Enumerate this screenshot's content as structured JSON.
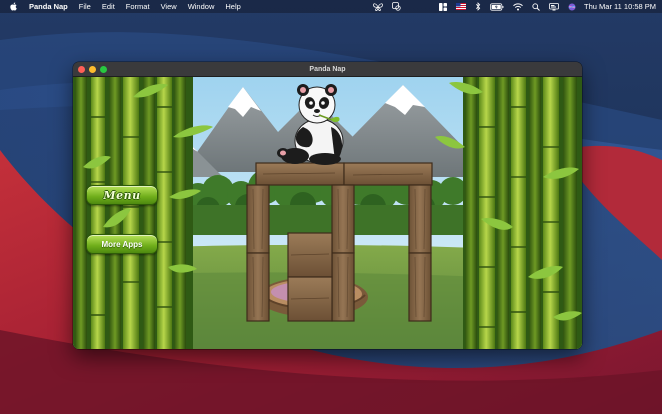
{
  "menubar": {
    "app_name": "Panda Nap",
    "menus": [
      "File",
      "Edit",
      "Format",
      "View",
      "Window",
      "Help"
    ],
    "clock": "Thu Mar 11  10:58 PM",
    "status_icons": [
      "butterfly-icon",
      "screen-share-icon",
      "control-center-grid-icon",
      "us-flag-icon",
      "bluetooth-icon",
      "battery-icon",
      "wifi-icon",
      "spotlight-search-icon",
      "display-icon",
      "siri-icon"
    ]
  },
  "window": {
    "title": "Panda Nap"
  },
  "game": {
    "menu_button": "Menu",
    "more_apps_button": "More Apps"
  },
  "colors": {
    "button_green": "#7bbc22",
    "sky": "#bfe3f6",
    "grass": "#6a9a3a",
    "wood": "#8a6b48"
  }
}
